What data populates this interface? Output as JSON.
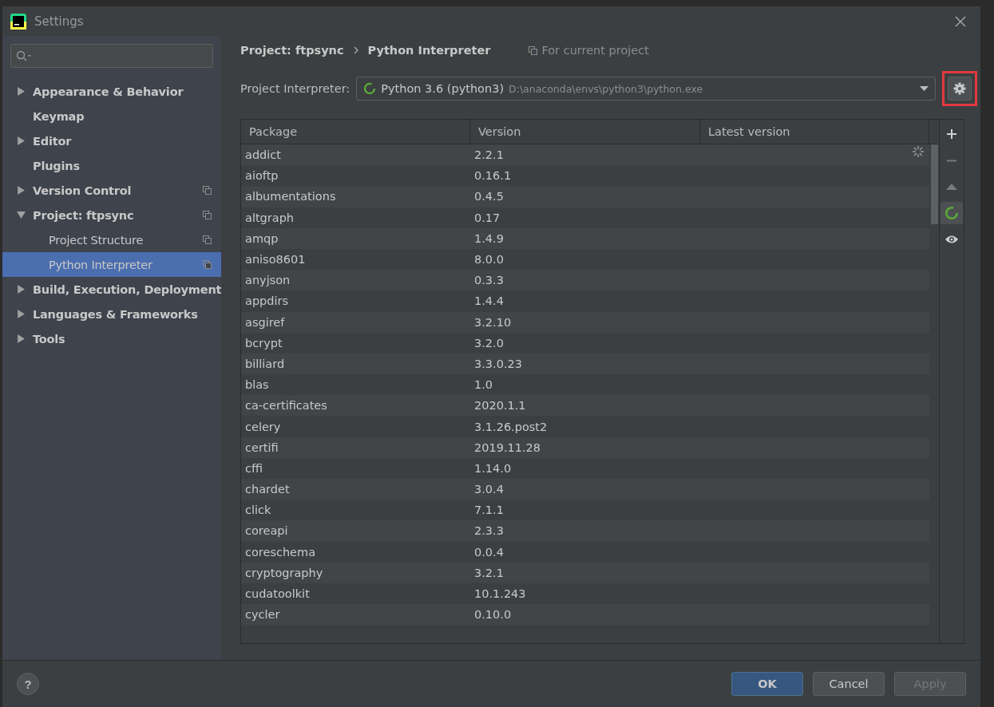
{
  "window": {
    "title": "Settings"
  },
  "sidebar": {
    "items": [
      {
        "label": "Appearance & Behavior",
        "expanded": false,
        "has_children": true,
        "project_scope": false,
        "selected": false
      },
      {
        "label": "Keymap",
        "has_children": false,
        "project_scope": false,
        "selected": false
      },
      {
        "label": "Editor",
        "expanded": false,
        "has_children": true,
        "project_scope": false,
        "selected": false
      },
      {
        "label": "Plugins",
        "has_children": false,
        "project_scope": false,
        "selected": false
      },
      {
        "label": "Version Control",
        "expanded": false,
        "has_children": true,
        "project_scope": true,
        "selected": false
      },
      {
        "label": "Project: ftpsync",
        "expanded": true,
        "has_children": true,
        "project_scope": true,
        "selected": false,
        "children": [
          {
            "label": "Project Structure",
            "project_scope": true,
            "selected": false
          },
          {
            "label": "Python Interpreter",
            "project_scope": true,
            "selected": true
          }
        ]
      },
      {
        "label": "Build, Execution, Deployment",
        "expanded": false,
        "has_children": true,
        "project_scope": false,
        "selected": false
      },
      {
        "label": "Languages & Frameworks",
        "expanded": false,
        "has_children": true,
        "project_scope": false,
        "selected": false
      },
      {
        "label": "Tools",
        "expanded": false,
        "has_children": true,
        "project_scope": false,
        "selected": false
      }
    ]
  },
  "breadcrumb": [
    "Project: ftpsync",
    "Python Interpreter"
  ],
  "scope_note": "For current project",
  "interpreter": {
    "label": "Project Interpreter:",
    "name": "Python 3.6 (python3)",
    "path": "D:\\anaconda\\envs\\python3\\python.exe",
    "highlighted_settings": true
  },
  "table": {
    "columns": [
      "Package",
      "Version",
      "Latest version"
    ],
    "loading": true,
    "rows": [
      {
        "package": "addict",
        "version": "2.2.1"
      },
      {
        "package": "aioftp",
        "version": "0.16.1"
      },
      {
        "package": "albumentations",
        "version": "0.4.5"
      },
      {
        "package": "altgraph",
        "version": "0.17"
      },
      {
        "package": "amqp",
        "version": "1.4.9"
      },
      {
        "package": "aniso8601",
        "version": "8.0.0"
      },
      {
        "package": "anyjson",
        "version": "0.3.3"
      },
      {
        "package": "appdirs",
        "version": "1.4.4"
      },
      {
        "package": "asgiref",
        "version": "3.2.10"
      },
      {
        "package": "bcrypt",
        "version": "3.2.0"
      },
      {
        "package": "billiard",
        "version": "3.3.0.23"
      },
      {
        "package": "blas",
        "version": "1.0"
      },
      {
        "package": "ca-certificates",
        "version": "2020.1.1"
      },
      {
        "package": "celery",
        "version": "3.1.26.post2"
      },
      {
        "package": "certifi",
        "version": "2019.11.28"
      },
      {
        "package": "cffi",
        "version": "1.14.0"
      },
      {
        "package": "chardet",
        "version": "3.0.4"
      },
      {
        "package": "click",
        "version": "7.1.1"
      },
      {
        "package": "coreapi",
        "version": "2.3.3"
      },
      {
        "package": "coreschema",
        "version": "0.0.4"
      },
      {
        "package": "cryptography",
        "version": "3.2.1"
      },
      {
        "package": "cudatoolkit",
        "version": "10.1.243"
      },
      {
        "package": "cycler",
        "version": "0.10.0"
      }
    ]
  },
  "table_tools": [
    {
      "kind": "add",
      "disabled": false,
      "selected": false
    },
    {
      "kind": "remove",
      "disabled": true,
      "selected": false
    },
    {
      "kind": "upgrade",
      "disabled": true,
      "selected": false
    },
    {
      "kind": "conda",
      "disabled": false,
      "selected": true
    },
    {
      "kind": "show",
      "disabled": false,
      "selected": false
    }
  ],
  "help": "?",
  "buttons": [
    {
      "label": "OK",
      "kind": "primary",
      "disabled": false
    },
    {
      "label": "Cancel",
      "kind": "default",
      "disabled": false
    },
    {
      "label": "Apply",
      "kind": "default",
      "disabled": true
    }
  ]
}
